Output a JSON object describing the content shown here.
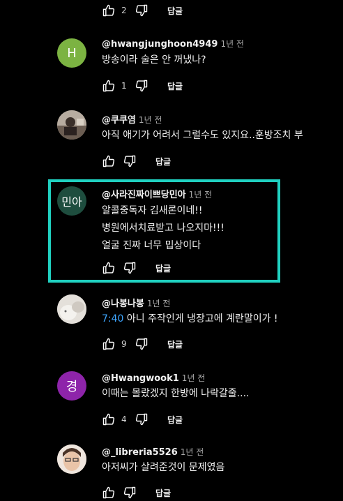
{
  "reply_label": "답글",
  "colors": {
    "highlight": "#20d0c0",
    "timestamp_link": "#3ea6ff"
  },
  "comments": [
    {
      "handle": "",
      "time": "",
      "lines": [],
      "likes": "2"
    },
    {
      "handle": "@hwangjunghoon4949",
      "time": "1년 전",
      "avatar_letter": "H",
      "avatar_color": "#7cb342",
      "lines": [
        "방송이라 술은 안 꺼냈나?"
      ],
      "likes": "1"
    },
    {
      "handle": "@쿠쿠염",
      "time": "1년 전",
      "avatar_icon": "photo-avatar",
      "lines": [
        "아직 애기가 어려서 그럴수도 있지요..훈방조치 부"
      ],
      "likes": ""
    },
    {
      "handle": "@사라진짜이쁘당민아",
      "time": "1년 전",
      "avatar_letter": "민아",
      "avatar_color": "#1e4d3e",
      "lines": [
        "알콜중독자 김새론이네!!",
        "병원에서치료받고 나오지마!!!",
        "얼굴 진짜 너무 밉상이다"
      ],
      "likes": ""
    },
    {
      "handle": "@나봉나봉",
      "time": "1년 전",
      "avatar_icon": "cat-photo-avatar",
      "timestamp": "7:40",
      "lines": [
        "아니 주작인게 냉장고에 계란말이가 !"
      ],
      "likes": "9"
    },
    {
      "handle": "@Hwangwook1",
      "time": "1년 전",
      "avatar_letter": "경",
      "avatar_color": "#8e24aa",
      "lines": [
        "이때는 몰랐겠지 한방에 나락갈줄...."
      ],
      "likes": "4"
    },
    {
      "handle": "@_libreria5526",
      "time": "1년 전",
      "avatar_icon": "person-photo-avatar",
      "lines": [
        "아저씨가 살려준것이 문제였음"
      ],
      "likes": ""
    }
  ]
}
